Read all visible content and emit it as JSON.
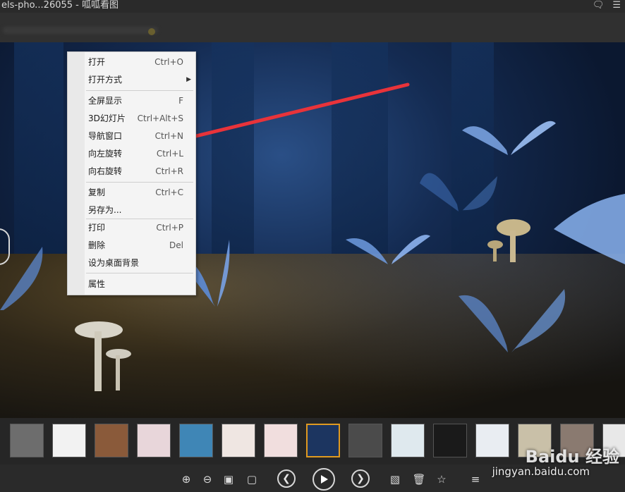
{
  "window": {
    "title": "els-pho...26055  -  呱呱看图"
  },
  "context_menu": {
    "items": [
      {
        "label": "打开",
        "shortcut": "Ctrl+O"
      },
      {
        "label": "打开方式",
        "shortcut": ""
      },
      {
        "label": "全屏显示",
        "shortcut": "F"
      },
      {
        "label": "3D幻灯片",
        "shortcut": "Ctrl+Alt+S"
      },
      {
        "label": "导航窗口",
        "shortcut": "Ctrl+N"
      },
      {
        "label": "向左旋转",
        "shortcut": "Ctrl+L"
      },
      {
        "label": "向右旋转",
        "shortcut": "Ctrl+R"
      },
      {
        "label": "复制",
        "shortcut": "Ctrl+C"
      },
      {
        "label": "另存为...",
        "shortcut": ""
      },
      {
        "label": "打印",
        "shortcut": "Ctrl+P"
      },
      {
        "label": "删除",
        "shortcut": "Del"
      },
      {
        "label": "设为桌面背景",
        "shortcut": ""
      },
      {
        "label": "属性",
        "shortcut": ""
      }
    ]
  },
  "thumbnails": [
    {
      "color": "#6d6d6d"
    },
    {
      "color": "#f2f2f2"
    },
    {
      "color": "#8a5a3a"
    },
    {
      "color": "#e8d6da"
    },
    {
      "color": "#3f86b6"
    },
    {
      "color": "#efe6e2"
    },
    {
      "color": "#f1dede"
    },
    {
      "color": "#1c3560"
    },
    {
      "color": "#4b4b4b"
    },
    {
      "color": "#dfe9ee"
    },
    {
      "color": "#1a1a1a"
    },
    {
      "color": "#e9edf2"
    },
    {
      "color": "#c9c0a8"
    },
    {
      "color": "#8a7a70"
    },
    {
      "color": "#e8e8e8"
    }
  ],
  "watermark": {
    "brand": "Baidu 经验",
    "url": "jingyan.baidu.com"
  },
  "colors": {
    "active_thumb_border": "#e09a20",
    "arrow": "#e8333a"
  }
}
